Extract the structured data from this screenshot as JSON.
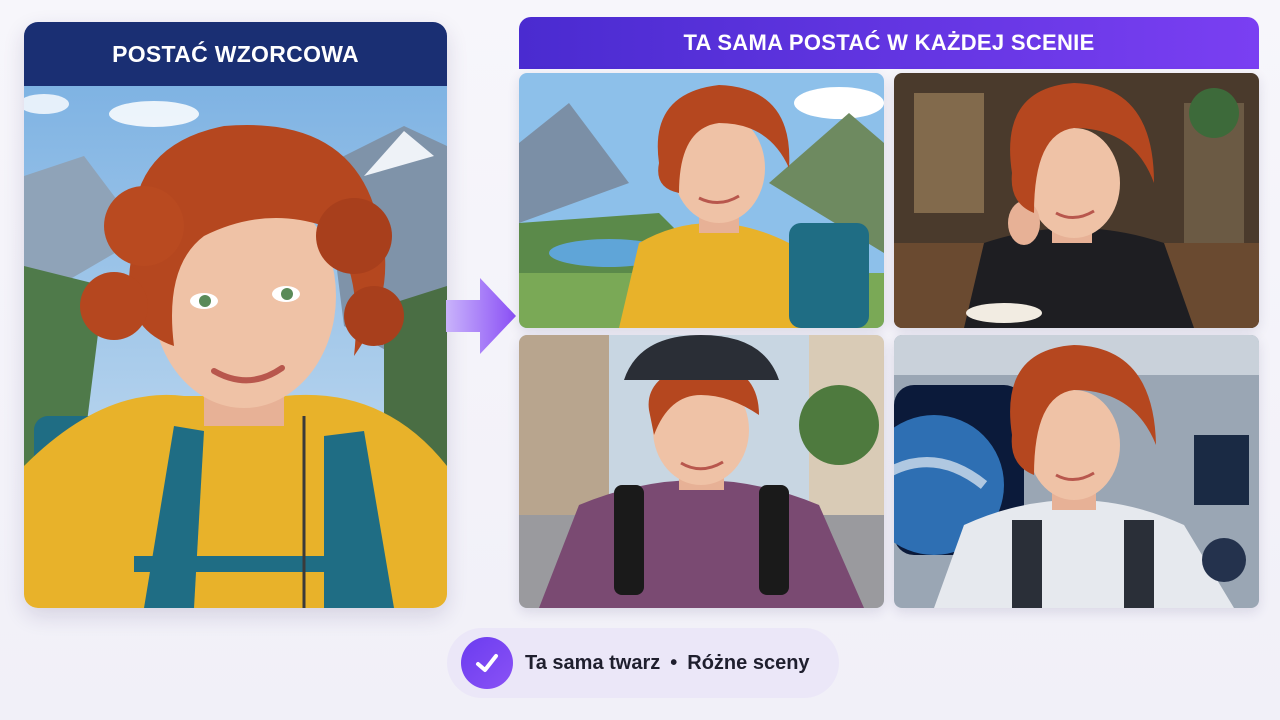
{
  "reference": {
    "title": "POSTAĆ WZORCOWA"
  },
  "scenes": {
    "title": "TA SAMA POSTAĆ W KAŻDEJ SCENIE",
    "items": [
      {
        "id": "hike",
        "name": "mountain-hiking-scene"
      },
      {
        "id": "cafe",
        "name": "cafe-scene"
      },
      {
        "id": "bike",
        "name": "city-cycling-scene"
      },
      {
        "id": "space",
        "name": "space-station-scene"
      }
    ]
  },
  "footer": {
    "left": "Ta sama twarz",
    "separator": "•",
    "right": "Różne sceny",
    "icon": "check-icon"
  },
  "colors": {
    "reference_header": "#1a2f73",
    "scenes_header_start": "#4a2bd0",
    "scenes_header_end": "#7a3ff2",
    "accent": "#7b45f2",
    "hair": "#b5471f",
    "jacket": "#e8b22a"
  }
}
